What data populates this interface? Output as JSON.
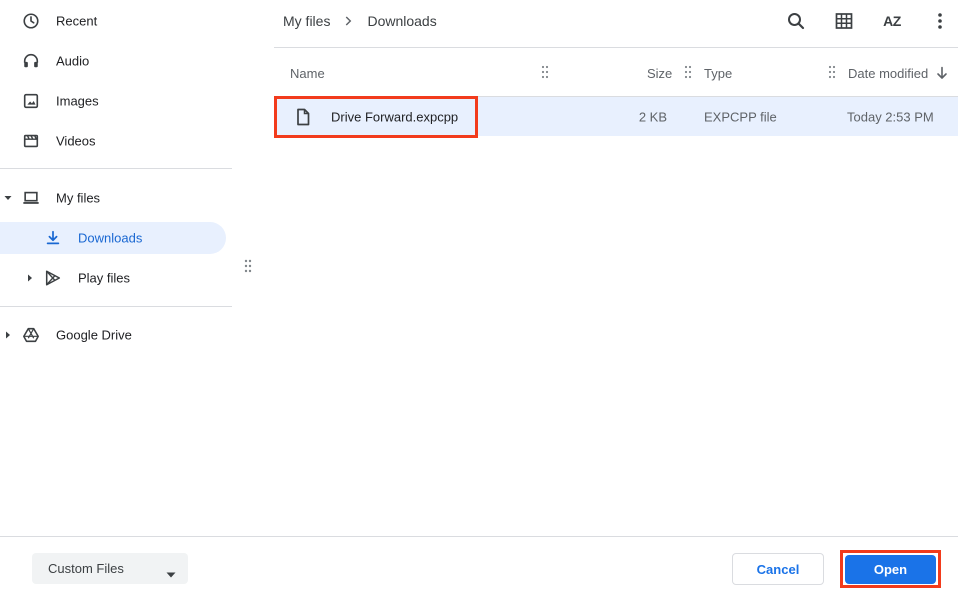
{
  "sidebar": {
    "recents": [
      {
        "label": "Recent",
        "icon": "clock-icon"
      },
      {
        "label": "Audio",
        "icon": "headphones-icon"
      },
      {
        "label": "Images",
        "icon": "image-icon"
      },
      {
        "label": "Videos",
        "icon": "video-icon"
      }
    ],
    "my_files": {
      "label": "My files",
      "icon": "laptop-icon"
    },
    "downloads": {
      "label": "Downloads",
      "icon": "download-icon"
    },
    "play_files": {
      "label": "Play files",
      "icon": "play-store-icon"
    },
    "google_drive": {
      "label": "Google Drive",
      "icon": "drive-icon"
    }
  },
  "breadcrumb": {
    "items": [
      "My files",
      "Downloads"
    ]
  },
  "toolbar": {
    "sort_label": "AZ"
  },
  "table": {
    "columns": {
      "name": "Name",
      "size": "Size",
      "type": "Type",
      "date": "Date modified"
    },
    "rows": [
      {
        "name": "Drive Forward.expcpp",
        "size": "2 KB",
        "type": "EXPCPP file",
        "date": "Today 2:53 PM",
        "icon": "file-icon"
      }
    ]
  },
  "footer": {
    "filter": "Custom Files",
    "cancel": "Cancel",
    "open": "Open"
  },
  "colors": {
    "accent": "#1a73e8",
    "selected_bg": "#e8f0fe",
    "highlight": "#f23b1c"
  }
}
